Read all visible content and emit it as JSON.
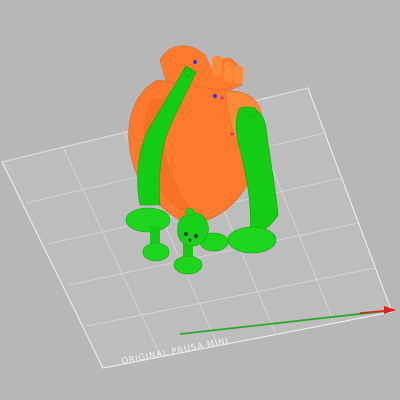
{
  "viewport": {
    "background_color": "#b7b7b7"
  },
  "bed": {
    "label": "ORIGINAL PRUSA MINI",
    "grid_color": "#e5e5e5",
    "outline_color": "#f2f2f2",
    "x_axis_color": "#e02020",
    "y_axis_color": "#22aa22"
  },
  "model": {
    "name": "heart-icon",
    "body_color": "#ff7a2e",
    "support_color": "#0fd10f"
  },
  "icons": [
    "heart-model-icon",
    "support-structure-icon",
    "x-axis-arrow-icon",
    "y-axis-line-icon"
  ]
}
